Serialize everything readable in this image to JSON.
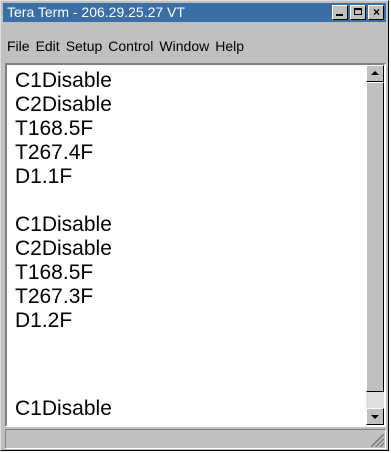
{
  "window": {
    "title": "Tera Term - 206.29.25.27 VT",
    "controls": {
      "minimize_icon": "minimize-icon",
      "maximize_icon": "maximize-icon",
      "close_icon": "close-icon",
      "close_glyph": "×"
    }
  },
  "menu": {
    "items": [
      {
        "label": "File"
      },
      {
        "label": "Edit"
      },
      {
        "label": "Setup"
      },
      {
        "label": "Control"
      },
      {
        "label": "Window"
      },
      {
        "label": "Help"
      }
    ]
  },
  "terminal": {
    "lines": [
      "C1Disable",
      "C2Disable",
      "T168.5F",
      "T267.4F",
      "D1.1F",
      "",
      "C1Disable",
      "C2Disable",
      "T168.5F",
      "T267.3F",
      "D1.2F",
      "",
      "C1Disable"
    ]
  },
  "colors": {
    "titlebar_bg": "#3a6ea5",
    "chrome_bg": "#c0c0c0",
    "terminal_bg": "#ffffff",
    "terminal_fg": "#000000"
  }
}
